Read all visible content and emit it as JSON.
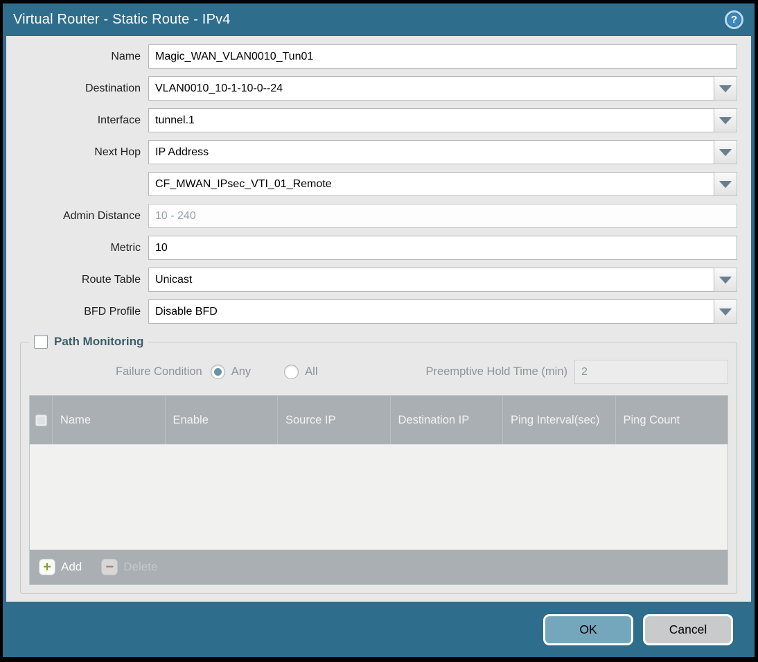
{
  "dialog": {
    "title": "Virtual Router - Static Route - IPv4",
    "help_glyph": "?"
  },
  "form": {
    "name": {
      "label": "Name",
      "value": "Magic_WAN_VLAN0010_Tun01"
    },
    "destination": {
      "label": "Destination",
      "value": "VLAN0010_10-1-10-0--24"
    },
    "interface": {
      "label": "Interface",
      "value": "tunnel.1"
    },
    "next_hop": {
      "label": "Next Hop",
      "value": "IP Address"
    },
    "next_hop_address": {
      "value": "CF_MWAN_IPsec_VTI_01_Remote"
    },
    "admin_distance": {
      "label": "Admin Distance",
      "placeholder": "10 - 240",
      "value": ""
    },
    "metric": {
      "label": "Metric",
      "value": "10"
    },
    "route_table": {
      "label": "Route Table",
      "value": "Unicast"
    },
    "bfd_profile": {
      "label": "BFD Profile",
      "value": "Disable BFD"
    }
  },
  "path_monitoring": {
    "legend": "Path Monitoring",
    "checked": false,
    "failure_condition": {
      "label": "Failure Condition",
      "options": [
        "Any",
        "All"
      ],
      "selected": "Any"
    },
    "preemptive_hold": {
      "label": "Preemptive Hold Time (min)",
      "value": "2"
    },
    "table": {
      "headers": [
        "",
        "Name",
        "Enable",
        "Source IP",
        "Destination IP",
        "Ping Interval(sec)",
        "Ping Count"
      ],
      "rows": []
    },
    "actions": {
      "add": "Add",
      "delete": "Delete"
    },
    "icons": {
      "add_glyph": "+",
      "delete_glyph": "−"
    }
  },
  "footer": {
    "ok": "OK",
    "cancel": "Cancel"
  },
  "colors": {
    "titlebar_teal": "#2E6D8C",
    "panel_bg": "#E8E8E8",
    "table_header_gray": "#A9AFB2",
    "ok_button": "#74A7BC",
    "cancel_button": "#C9CACC",
    "legend_text": "#3E5C69",
    "add_icon_green": "#7DA32E",
    "delete_icon_red": "#B06A57",
    "radio_selected": "#6795A7"
  }
}
